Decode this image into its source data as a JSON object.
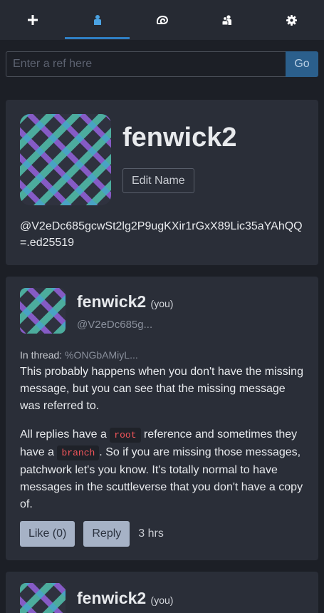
{
  "nav": {
    "tabs": [
      {
        "name": "compose",
        "icon": "plus-icon",
        "active": false
      },
      {
        "name": "profile",
        "icon": "person-icon",
        "active": true
      },
      {
        "name": "feed",
        "icon": "spiral-shell-icon",
        "active": false
      },
      {
        "name": "contacts",
        "icon": "people-icon",
        "active": false
      },
      {
        "name": "settings",
        "icon": "gear-icon",
        "active": false
      }
    ],
    "accent_color": "#2f7fc4"
  },
  "search": {
    "placeholder": "Enter a ref here",
    "go_label": "Go"
  },
  "profile": {
    "name": "fenwick2",
    "edit_label": "Edit Name",
    "id": "@V2eDc685gcwSt2lg2P9ugKXir1rGxX89Lic35aYAhQQ=.ed25519"
  },
  "posts": [
    {
      "author": "fenwick2",
      "you_label": "(you)",
      "handle": "@V2eDc685g...",
      "thread_label": "In thread:",
      "thread_ref": "%ONGbAMiyL...",
      "para1": "This probably happens when you don't have the missing message, but you can see that the missing message was referred to.",
      "para2_a": "All replies have a ",
      "code1": "root",
      "para2_b": " reference and sometimes they have a ",
      "code2": "branch",
      "para2_c": ". So if you are missing those messages, patchwork let's you know. It's totally normal to have messages in the scuttleverse that you don't have a copy of.",
      "like_label": "Like (0)",
      "reply_label": "Reply",
      "time": "3 hrs"
    },
    {
      "author": "fenwick2",
      "you_label": "(you)"
    }
  ]
}
